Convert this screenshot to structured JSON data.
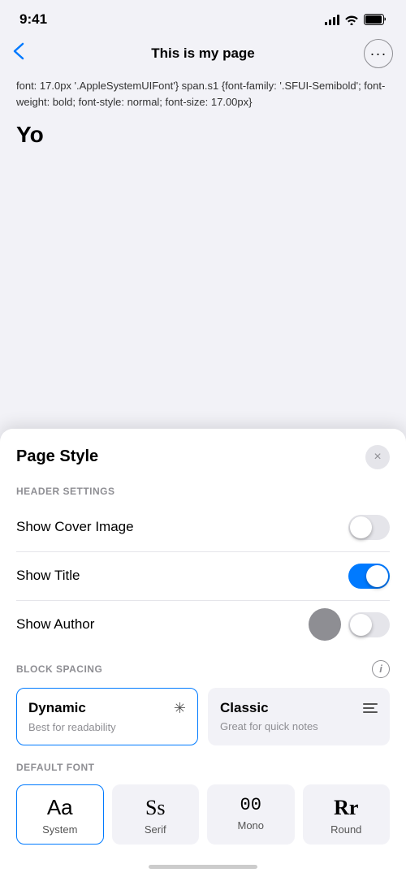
{
  "statusBar": {
    "time": "9:41",
    "signal": "signal-icon",
    "wifi": "wifi-icon",
    "battery": "battery-icon"
  },
  "navBar": {
    "back": "<",
    "title": "This is my page",
    "more": "···"
  },
  "pageContent": {
    "code": "font: 17.0px '.AppleSystemUIFont'} span.s1 {font-family: '.SFUI-Semibold'; font-weight: bold; font-style: normal; font-size: 17.00px}",
    "heading": "Yo"
  },
  "bottomSheet": {
    "title": "Page Style",
    "close": "×",
    "headerSettings": {
      "label": "HEADER SETTINGS",
      "items": [
        {
          "id": "show-cover-image",
          "label": "Show Cover Image",
          "state": "off"
        },
        {
          "id": "show-title",
          "label": "Show Title",
          "state": "on"
        },
        {
          "id": "show-author",
          "label": "Show Author",
          "state": "off",
          "hasOverlay": true
        }
      ]
    },
    "blockSpacing": {
      "label": "BLOCK SPACING",
      "infoIcon": "i",
      "options": [
        {
          "id": "dynamic",
          "name": "Dynamic",
          "desc": "Best for readability",
          "icon": "dynamic",
          "selected": true
        },
        {
          "id": "classic",
          "name": "Classic",
          "desc": "Great for quick notes",
          "icon": "menu",
          "selected": false
        }
      ]
    },
    "defaultFont": {
      "label": "DEFAULT FONT",
      "options": [
        {
          "id": "system",
          "glyph": "Aa",
          "name": "System",
          "style": "system",
          "selected": true
        },
        {
          "id": "serif",
          "glyph": "Ss",
          "name": "Serif",
          "style": "serif",
          "selected": false
        },
        {
          "id": "mono",
          "glyph": "00",
          "name": "Mono",
          "style": "mono",
          "selected": false
        },
        {
          "id": "round",
          "glyph": "Rr",
          "name": "Round",
          "style": "round",
          "selected": false
        }
      ]
    }
  }
}
